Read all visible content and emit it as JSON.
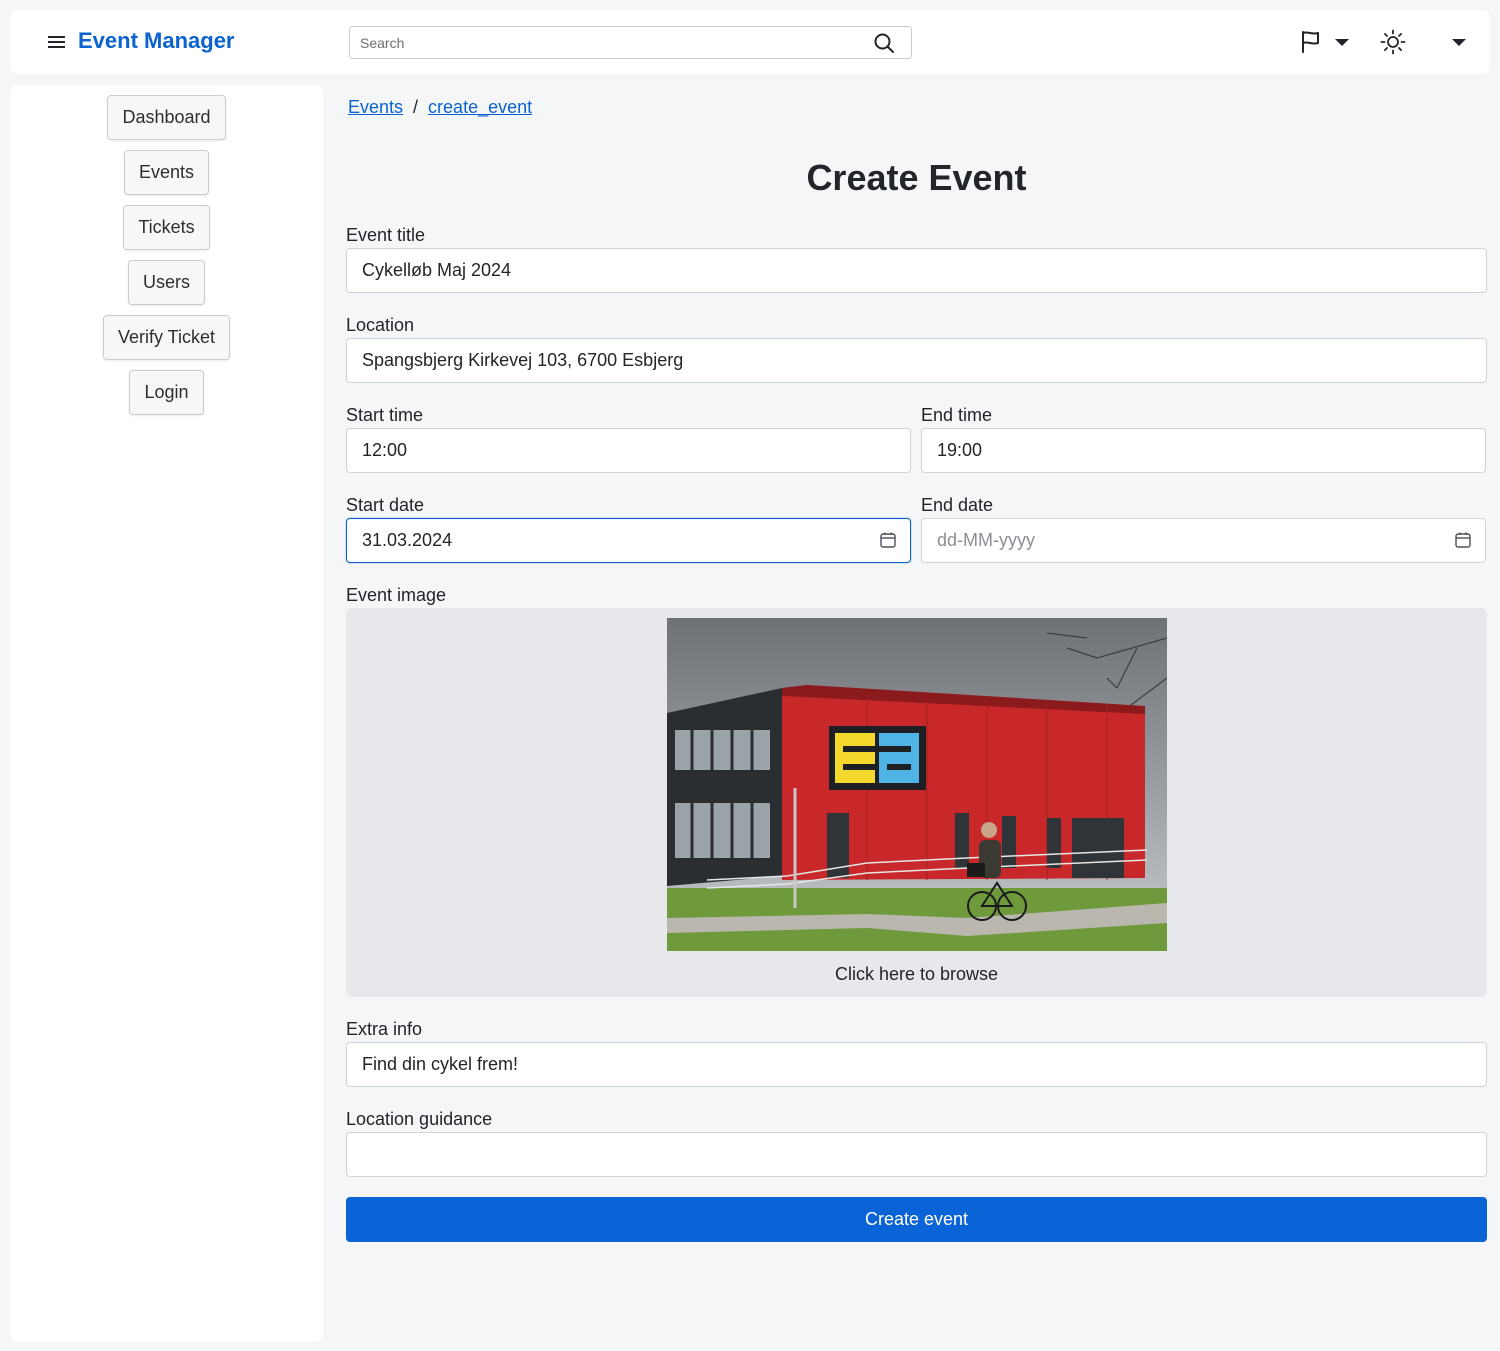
{
  "header": {
    "app_title": "Event Manager",
    "search_placeholder": "Search",
    "icons": [
      "menu-icon",
      "search-icon",
      "flag-icon",
      "sun-icon",
      "chevron-down-icon"
    ]
  },
  "sidebar": {
    "items": [
      {
        "label": "Dashboard"
      },
      {
        "label": "Events"
      },
      {
        "label": "Tickets"
      },
      {
        "label": "Users"
      },
      {
        "label": "Verify Ticket"
      },
      {
        "label": "Login"
      }
    ]
  },
  "breadcrumb": {
    "items": [
      "Events",
      "create_event"
    ],
    "separator": "/"
  },
  "page_title": "Create Event",
  "form": {
    "event_title": {
      "label": "Event title",
      "value": "Cykelløb Maj 2024"
    },
    "location": {
      "label": "Location",
      "value": "Spangsbjerg Kirkevej 103, 6700 Esbjerg"
    },
    "start_time": {
      "label": "Start time",
      "value": "12:00"
    },
    "end_time": {
      "label": "End time",
      "value": "19:00"
    },
    "start_date": {
      "label": "Start date",
      "value": "31.03.2024"
    },
    "end_date": {
      "label": "End date",
      "value": "",
      "placeholder": "dd-MM-yyyy"
    },
    "event_image": {
      "label": "Event image",
      "browse_text": "Click here to browse",
      "logo_text": "ea"
    },
    "extra_info": {
      "label": "Extra info",
      "value": "Find din cykel frem!"
    },
    "location_guidance": {
      "label": "Location guidance",
      "value": ""
    },
    "submit_label": "Create event"
  },
  "colors": {
    "accent": "#0b63cf",
    "button": "#0b63d8",
    "page_bg": "#f5f6f8",
    "image_area_bg": "#e7e8eb"
  }
}
